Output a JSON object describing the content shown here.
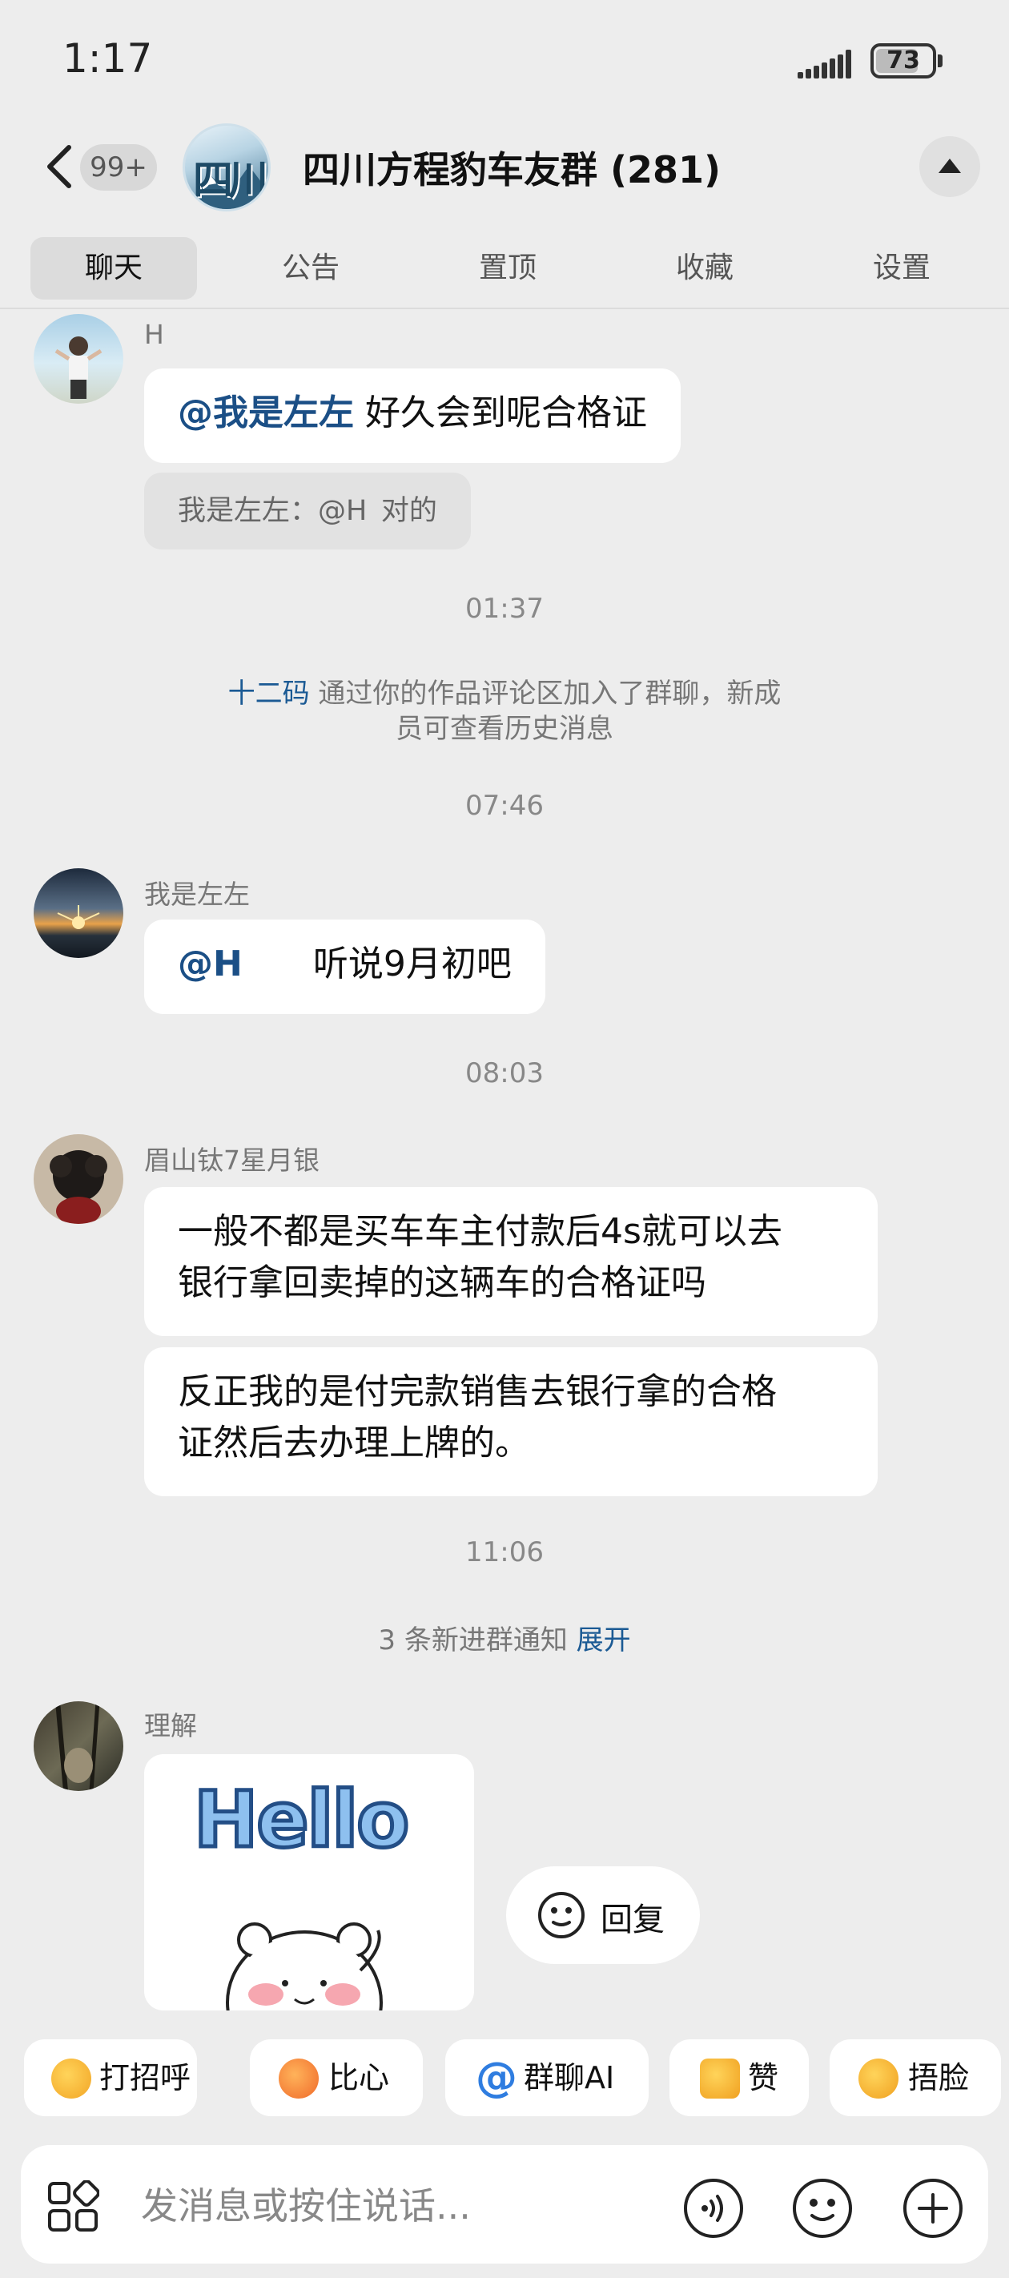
{
  "status_bar": {
    "time": "1:17",
    "battery": "73"
  },
  "header": {
    "back_badge": "99+",
    "group_avatar_text": "四川",
    "title": "四川方程豹车友群 (281)"
  },
  "tabs": [
    {
      "label": "聊天"
    },
    {
      "label": "公告"
    },
    {
      "label": "置顶"
    },
    {
      "label": "收藏"
    },
    {
      "label": "设置"
    }
  ],
  "messages": {
    "m1": {
      "sender": "H",
      "mention": "@我是左左",
      "text": " 好久会到呢合格证",
      "quote": "我是左左：@H  对的"
    },
    "t1": "01:37",
    "join_notice": {
      "name": "十二码",
      "text_line1": " 通过你的作品评论区加入了群聊，新成",
      "text_line2": "员可查看历史消息"
    },
    "t2": "07:46",
    "m2": {
      "sender": "我是左左",
      "mention": "@H",
      "text": "  听说9月初吧"
    },
    "t3": "08:03",
    "m3": {
      "sender": "眉山钛7星月银",
      "bubble1_line1": "一般不都是买车车主付款后4s就可以去",
      "bubble1_line2": "银行拿回卖掉的这辆车的合格证吗",
      "bubble2_line1": "反正我的是付完款销售去银行拿的合格",
      "bubble2_line2": "证然后去办理上牌的。"
    },
    "t4": "11:06",
    "new_members": {
      "text": "3 条新进群通知 ",
      "action": "展开"
    },
    "m4": {
      "sender": "理解",
      "sticker_text": "Hello"
    }
  },
  "reply_pill": {
    "label": "回复"
  },
  "quick_replies": [
    {
      "label": "打招呼",
      "icon": "wave-emoji-icon"
    },
    {
      "label": "比心",
      "icon": "heart-hands-emoji-icon"
    },
    {
      "label": "群聊AI",
      "icon": "at-icon",
      "prefix": "@"
    },
    {
      "label": "赞",
      "icon": "thumbs-up-emoji-icon"
    },
    {
      "label": "捂脸",
      "icon": "facepalm-emoji-icon"
    }
  ],
  "input": {
    "placeholder": "发消息或按住说话..."
  },
  "colors": {
    "background": "#ededed",
    "mention": "#1b4f86",
    "link": "#1b5a94",
    "bubble": "#ffffff"
  }
}
